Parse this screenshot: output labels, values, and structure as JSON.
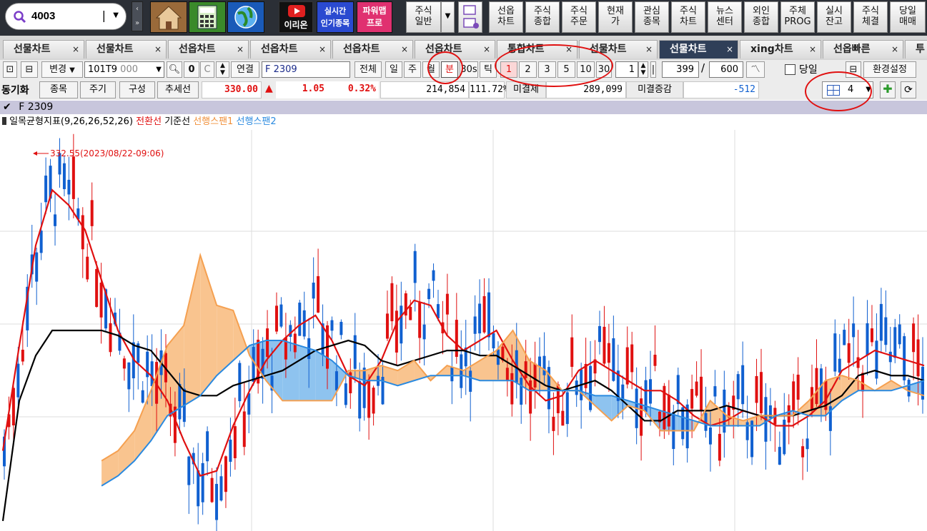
{
  "search": {
    "value": "4003"
  },
  "toolbar": {
    "quick": [
      {
        "name": "home-icon"
      },
      {
        "name": "calculator-icon"
      },
      {
        "name": "globe-icon"
      }
    ],
    "youtube_label": "이리온",
    "realtime_top": "실시간",
    "realtime_bottom": "인기종목",
    "powermap_top": "파워맵",
    "powermap_bottom": "프로",
    "buttons": [
      {
        "top": "주식",
        "bottom": "일반"
      },
      {
        "top": "선옵",
        "bottom": "차트"
      },
      {
        "top": "주식",
        "bottom": "종합"
      },
      {
        "top": "주식",
        "bottom": "주문"
      },
      {
        "top": "현재",
        "bottom": "가"
      },
      {
        "top": "관심",
        "bottom": "종목"
      },
      {
        "top": "주식",
        "bottom": "차트"
      },
      {
        "top": "뉴스",
        "bottom": "센터"
      },
      {
        "top": "외인",
        "bottom": "종합"
      },
      {
        "top": "주체",
        "bottom": "PROG"
      },
      {
        "top": "실시",
        "bottom": "잔고"
      },
      {
        "top": "주식",
        "bottom": "체결"
      },
      {
        "top": "당일",
        "bottom": "매매"
      }
    ]
  },
  "tabs": [
    {
      "label": "선물차트"
    },
    {
      "label": "선물차트"
    },
    {
      "label": "선옵차트"
    },
    {
      "label": "선옵차트"
    },
    {
      "label": "선옵차트"
    },
    {
      "label": "선옵차트"
    },
    {
      "label": "통합차트"
    },
    {
      "label": "선물차트"
    },
    {
      "label": "선물차트"
    },
    {
      "label": "xing차트"
    },
    {
      "label": "선옵빠른"
    },
    {
      "label": "투"
    }
  ],
  "tab_close": "×",
  "controls": {
    "change_label": "변경",
    "code": "101T9",
    "code_suffix": "000",
    "link_label": "연결",
    "instrument": "F 2309",
    "all_label": "전체",
    "day": "일",
    "week": "주",
    "month": "월",
    "minute": "분",
    "seconds30": "30s",
    "tick": "틱",
    "intervals": [
      "1",
      "2",
      "3",
      "5",
      "10",
      "30"
    ],
    "unit_value": "1",
    "count_value": "399",
    "slash": "/",
    "total_value": "600",
    "today_label": "당일",
    "settings_label": "환경설정"
  },
  "info": {
    "sync_label": "동기화",
    "item_label": "종목",
    "period_label": "주기",
    "config_label": "구성",
    "trendline_label": "추세선",
    "price": "330.00",
    "change_arrow": "▲",
    "change": "1.05",
    "change_pct": "0.32%",
    "volume": "214,854",
    "volume_ratio": "111.72%",
    "oi_label": "미결제",
    "oi": "289,099",
    "oi_change_label": "미결증감",
    "oi_change": "-512",
    "layout_count": "4"
  },
  "chart_title": "F 2309",
  "legend": {
    "indicator": "일목균형지표(9,26,26,52,26)",
    "conversion": "전환선",
    "base": "기준선",
    "span1": "선행스팬1",
    "span2": "선행스팬2"
  },
  "colors": {
    "up": "#e01010",
    "down": "#1060d0",
    "conversion": "#e01010",
    "base": "#000000",
    "span1": "#f5a050",
    "span2": "#2a8ae0",
    "cloud_bull": "#f9c48f",
    "cloud_bear": "#8ec3ef",
    "tab_active": "#2f3f58"
  },
  "chart_data": {
    "type": "line",
    "max_annotation": "332.55(2023/08/22-09:06)",
    "series": [
      {
        "name": "전환선",
        "values": [
          326.8,
          328.9,
          330.9,
          332.0,
          331.7,
          331.2,
          330.2,
          329.2,
          328.6,
          328.3,
          327.8,
          327.0,
          326.3,
          326.4,
          327.3,
          328.0,
          328.6,
          329.0,
          329.3,
          329.5,
          329.0,
          328.3,
          328.1,
          328.6,
          329.4,
          329.8,
          329.7,
          329.1,
          328.8,
          329.0,
          329.2,
          328.6,
          328.1,
          327.8,
          327.9,
          328.4,
          328.6,
          328.4,
          328.2,
          328.0,
          328.0,
          327.8,
          327.5,
          327.3,
          327.4,
          327.6,
          327.5,
          327.3,
          327.3,
          327.5,
          327.8,
          328.4,
          328.6,
          328.8,
          328.7,
          328.6,
          328.5
        ]
      },
      {
        "name": "기준선",
        "values": [
          325.4,
          327.8,
          328.7,
          329.2,
          329.2,
          329.2,
          329.2,
          329.1,
          328.9,
          328.8,
          328.4,
          328.0,
          327.9,
          327.9,
          328.1,
          328.2,
          328.3,
          328.4,
          328.6,
          328.8,
          328.9,
          329.0,
          328.9,
          328.6,
          328.5,
          328.6,
          328.7,
          328.8,
          328.8,
          328.7,
          328.7,
          328.5,
          328.3,
          328.1,
          328.0,
          328.1,
          328.2,
          328.0,
          327.7,
          327.4,
          327.4,
          327.6,
          327.6,
          327.6,
          327.7,
          327.6,
          327.5,
          327.5,
          327.5,
          327.6,
          327.7,
          327.9,
          328.3,
          328.4,
          328.3,
          328.3,
          328.2
        ]
      },
      {
        "name": "선행스팬1",
        "values": [
          null,
          null,
          null,
          null,
          null,
          null,
          326.6,
          326.8,
          327.2,
          328.0,
          328.9,
          329.3,
          330.7,
          329.7,
          329.6,
          328.7,
          328.2,
          327.8,
          327.8,
          327.8,
          327.8,
          328.4,
          328.4,
          328.5,
          328.4,
          328.6,
          328.2,
          328.5,
          328.4,
          328.6,
          328.8,
          329.2,
          328.6,
          328.4,
          328.0,
          328.0,
          327.7,
          327.4,
          327.7,
          327.6,
          327.2,
          327.2,
          327.2,
          327.8,
          327.5,
          327.4,
          327.5,
          327.5,
          327.5,
          327.8,
          328.2,
          328.3,
          328.2,
          328.0,
          328.2,
          328.0,
          327.9
        ]
      },
      {
        "name": "선행스팬2",
        "values": [
          null,
          null,
          null,
          null,
          null,
          null,
          326.1,
          326.3,
          326.6,
          327.0,
          327.5,
          327.7,
          327.9,
          328.3,
          328.6,
          328.9,
          329.0,
          329.0,
          328.9,
          328.8,
          328.6,
          328.3,
          328.2,
          328.2,
          328.1,
          328.2,
          328.3,
          328.3,
          328.3,
          328.2,
          328.2,
          328.2,
          328.0,
          328.0,
          328.0,
          328.0,
          327.9,
          327.9,
          327.8,
          327.7,
          327.6,
          327.5,
          327.4,
          327.3,
          327.3,
          327.3,
          327.3,
          327.5,
          327.6,
          327.5,
          327.5,
          327.8,
          328.0,
          328.0,
          328.0,
          328.1,
          328.2
        ]
      }
    ],
    "ylim": [
      325.2,
      333.2
    ]
  }
}
